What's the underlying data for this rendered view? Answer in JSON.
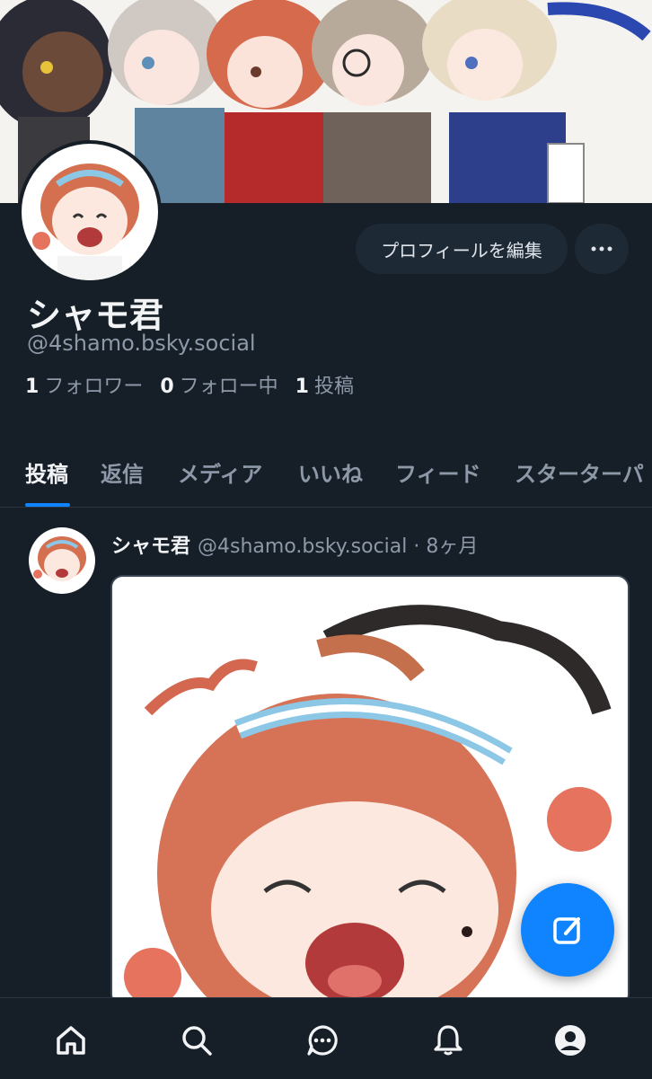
{
  "profile": {
    "display_name": "シャモ君",
    "handle": "@4shamo.bsky.social",
    "edit_button_label": "プロフィールを編集",
    "stats": {
      "followers_count": "1",
      "followers_label": "フォロワー",
      "following_count": "0",
      "following_label": "フォロー中",
      "posts_count": "1",
      "posts_label": "投稿"
    }
  },
  "tabs": [
    {
      "label": "投稿",
      "active": true
    },
    {
      "label": "返信",
      "active": false
    },
    {
      "label": "メディア",
      "active": false
    },
    {
      "label": "いいね",
      "active": false
    },
    {
      "label": "フィード",
      "active": false
    },
    {
      "label": "スターターパ",
      "active": false
    }
  ],
  "post": {
    "author_name": "シャモ君",
    "author_handle": "@4shamo.bsky.social",
    "time_ago": "· 8ヶ月"
  },
  "bottom_nav": [
    "home-icon",
    "search-icon",
    "chat-icon",
    "bell-icon",
    "profile-icon"
  ],
  "colors": {
    "background": "#161e27",
    "accent": "#1083fe",
    "muted_text": "#8d99a8"
  }
}
